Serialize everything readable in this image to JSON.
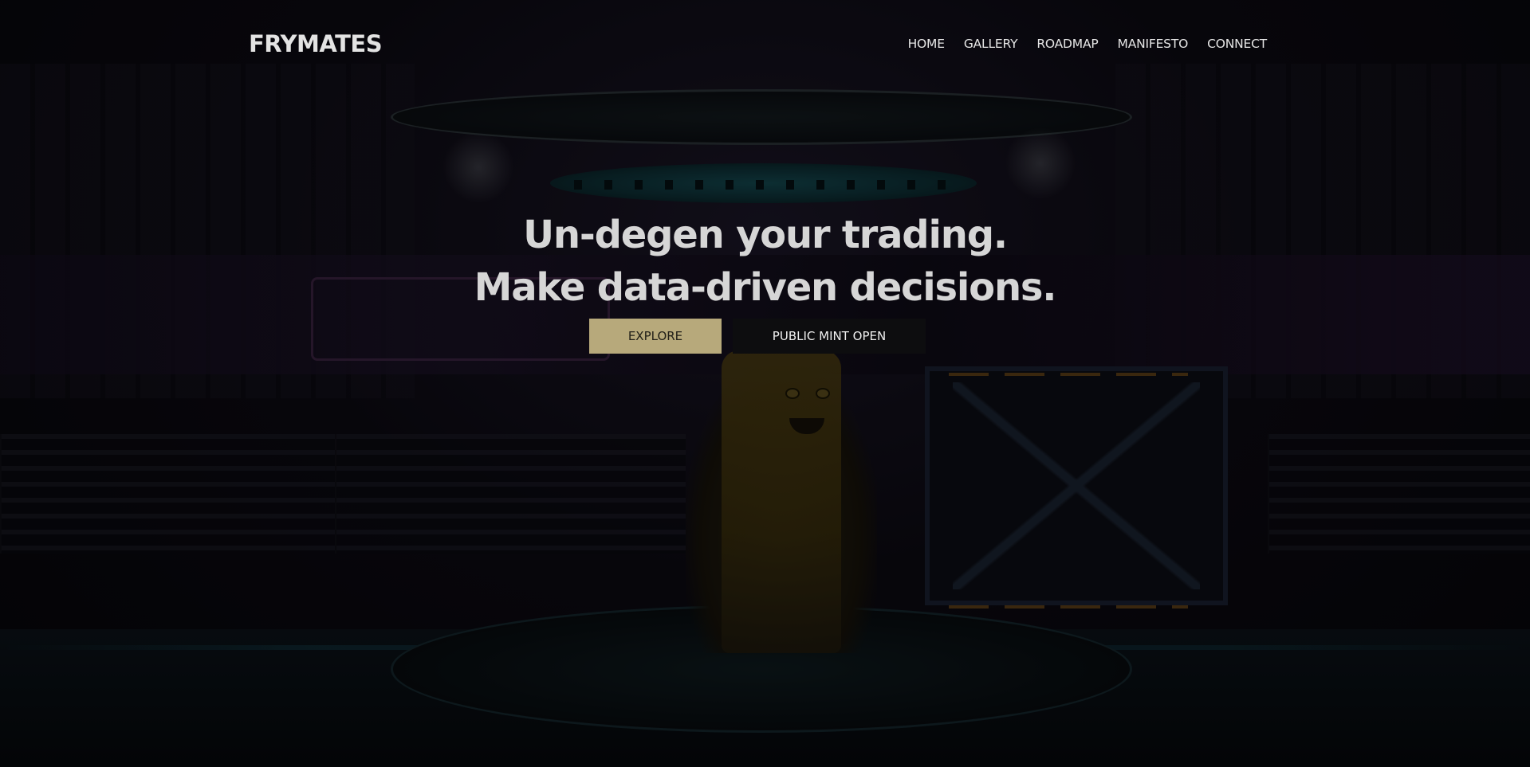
{
  "nav": {
    "logo": "FRYMATES",
    "links": [
      "HOME",
      "GALLERY",
      "ROADMAP",
      "MANIFESTO",
      "CONNECT"
    ]
  },
  "hero": {
    "title_line1": "Un-degen your trading.",
    "title_line2": "Make data-driven decisions.",
    "explore_label": "EXPLORE",
    "mint_label": "PUBLIC MINT OPEN"
  },
  "colors": {
    "accent": "#b7a97b",
    "background": "#050508",
    "text": "#d6d6d6"
  }
}
